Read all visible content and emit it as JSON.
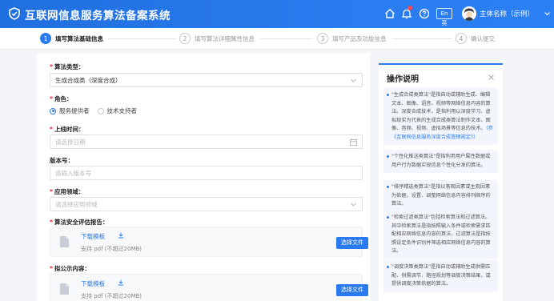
{
  "header": {
    "title": "互联网信息服务算法备案系统",
    "lang_label": "En 英",
    "user_name": "主体名称（示例）",
    "icons": [
      "shield-logo-icon",
      "home-icon",
      "bell-icon",
      "help-circle-icon",
      "language-toggle",
      "user-avatar",
      "chevron-down-icon"
    ]
  },
  "steps": [
    {
      "num": "1",
      "label": "填写算法基础信息",
      "active": true
    },
    {
      "num": "2",
      "label": "填写算法详细属性信息",
      "active": false
    },
    {
      "num": "3",
      "label": "填写产品及功能信息",
      "active": false
    },
    {
      "num": "4",
      "label": "确认提交",
      "active": false
    }
  ],
  "form": {
    "algo_type": {
      "label": "算法类型：",
      "value": "生成合成类（深度合成）"
    },
    "role": {
      "label": "角色：",
      "options": [
        "服务提供者",
        "技术支持者"
      ],
      "selected": "服务提供者"
    },
    "launch_time": {
      "label": "上线时间：",
      "placeholder": "请选择日期"
    },
    "version": {
      "label": "版本号：",
      "placeholder": "请输入版本号"
    },
    "domain": {
      "label": "应用领域：",
      "placeholder": "请选择应用领域"
    },
    "security_report": {
      "label": "算法安全评估报告：",
      "download": "下载模板",
      "hint": "支持 pdf (不超过20MB)",
      "button": "选择文件"
    },
    "public_content": {
      "label": "拟公示内容：",
      "download": "下载模板",
      "hint": "支持 pdf (不超过20MB)",
      "button": "选择文件"
    }
  },
  "help": {
    "title": "操作说明",
    "items": [
      {
        "text": "\"生成合成类算法\"是指自动或辅助生成、编辑文本、图像、语音、视频等网络信息内容的算法。深度合成技术，是指利用以深度学习、虚拟现实为代表的生成合成类算法制作文本、图像、音频、视频、虚拟场景等信息的技术。",
        "link": "（参《互联网信息服务深度合成管理规定》）"
      },
      {
        "text": "\"个性化推送类算法\"是指利用用户属性数据或用户行为数据实现信息个性化分发的算法。",
        "link": ""
      },
      {
        "text": "\"排序精选类算法\"是指以客观因素或主观因素为依据，设置、调整网络信息内容排列顺序的算法。",
        "link": ""
      },
      {
        "text": "\"检索过滤类算法\"包括检索算法和过滤算法。其中检索算法是指按照输入条件或检索需求匹配相应网络信息内容的算法，过滤算法是指按照设定条件识别并筛选相应网络信息内容的算法。",
        "link": ""
      },
      {
        "text": "\"调度决策类算法\"是指自动或辅助生成供需匹配、供需调节、路径规划等调度决策结果，或提供调度决策依据的算法。",
        "link": ""
      }
    ]
  }
}
